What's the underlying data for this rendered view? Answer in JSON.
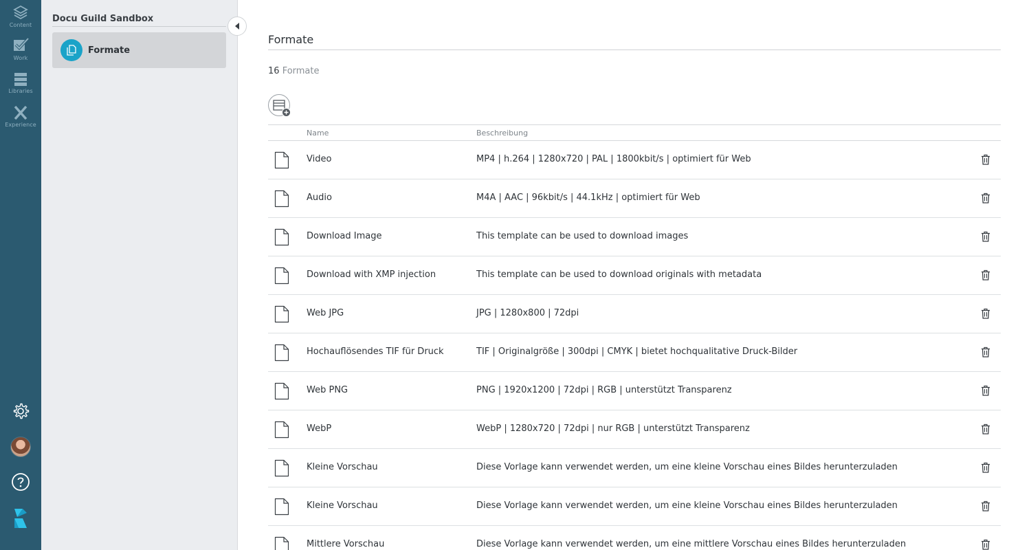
{
  "rail": {
    "items": [
      {
        "label": "Content",
        "icon": "layers-icon"
      },
      {
        "label": "Work",
        "icon": "check-icon"
      },
      {
        "label": "Libraries",
        "icon": "libraries-icon"
      },
      {
        "label": "Experience",
        "icon": "experience-icon"
      }
    ],
    "bottom": [
      "gear-icon",
      "avatar",
      "help-icon",
      "brand-logo"
    ]
  },
  "sidebar": {
    "title": "Docu Guild Sandbox",
    "items": [
      {
        "label": "Formate",
        "icon": "copy-icon",
        "active": true
      }
    ]
  },
  "main": {
    "title": "Formate",
    "count_number": "16",
    "count_label": "Formate",
    "columns": {
      "name": "Name",
      "description": "Beschreibung"
    },
    "rows": [
      {
        "name": "Video",
        "description": "MP4 | h.264 | 1280x720 | PAL | 1800kbit/s | optimiert für Web"
      },
      {
        "name": "Audio",
        "description": "M4A | AAC | 96kbit/s | 44.1kHz | optimiert für Web"
      },
      {
        "name": "Download Image",
        "description": "This template can be used to download images"
      },
      {
        "name": "Download with XMP injection",
        "description": "This template can be used to download originals with metadata"
      },
      {
        "name": "Web JPG",
        "description": "JPG | 1280x800 | 72dpi"
      },
      {
        "name": "Hochauflösendes TIF für Druck",
        "description": "TIF | Originalgröße | 300dpi | CMYK | bietet hochqualitative Druck-Bilder"
      },
      {
        "name": "Web PNG",
        "description": "PNG | 1920x1200 | 72dpi | RGB | unterstützt Transparenz"
      },
      {
        "name": "WebP",
        "description": "WebP | 1280x720 | 72dpi | nur RGB | unterstützt Transparenz"
      },
      {
        "name": "Kleine Vorschau",
        "description": "Diese Vorlage kann verwendet werden, um eine kleine Vorschau eines Bildes herunterzuladen"
      },
      {
        "name": "Kleine Vorschau",
        "description": "Diese Vorlage kann verwendet werden, um eine kleine Vorschau eines Bildes herunterzuladen"
      },
      {
        "name": "Mittlere Vorschau",
        "description": "Diese Vorlage kann verwendet werden, um eine mittlere Vorschau eines Bildes herunterzuladen"
      }
    ]
  },
  "colors": {
    "rail": "#2b5a70",
    "sidebar": "#ebedf0",
    "accent": "#1aa3c8"
  }
}
